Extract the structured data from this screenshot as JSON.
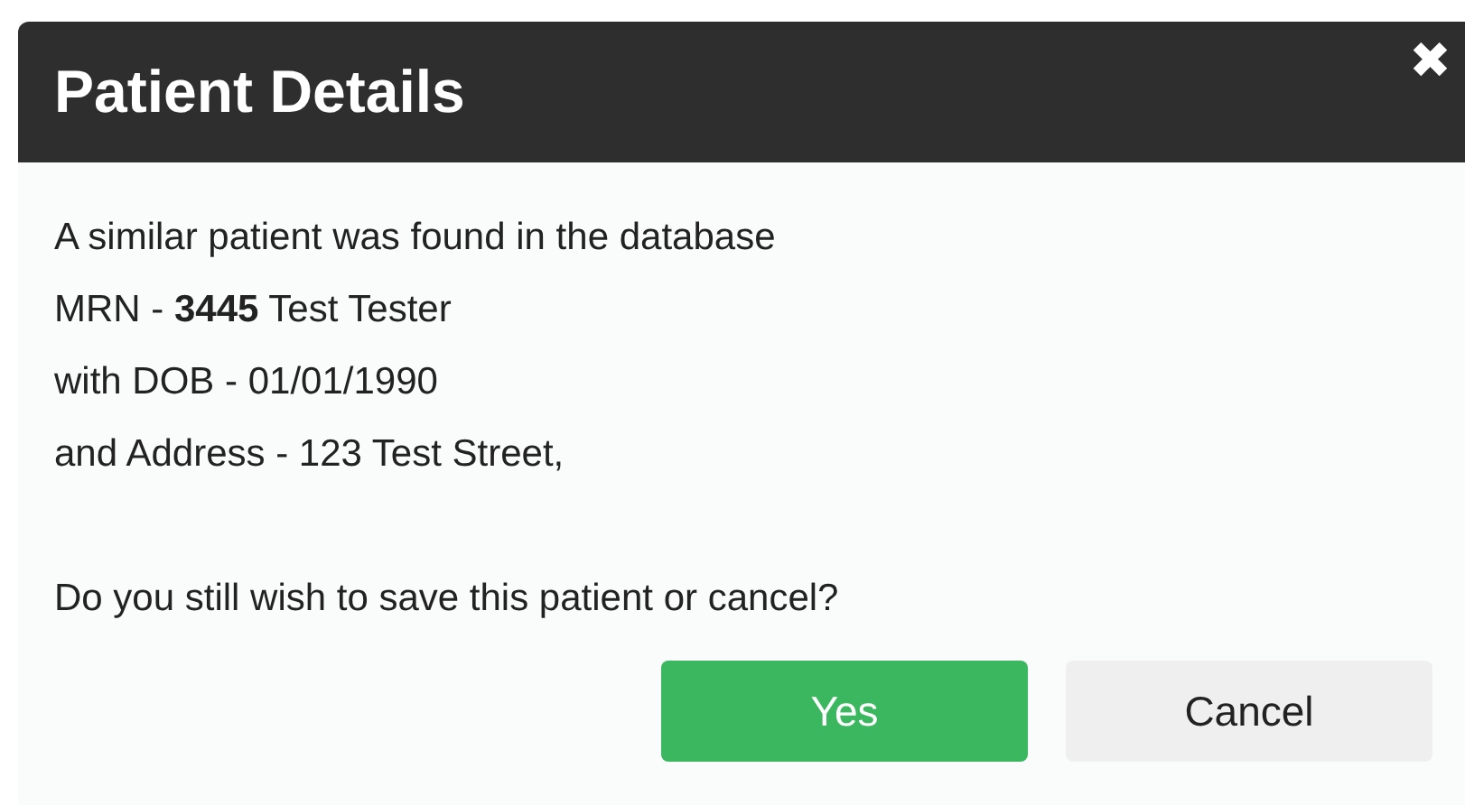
{
  "dialog": {
    "title": "Patient Details",
    "close": "✖",
    "message_lines": [
      "A similar patient was found in the database",
      "MRN - **3445** Test Tester",
      "with DOB - 01/01/1990",
      "and Address - 123 Test Street,"
    ],
    "question": "Do you still wish to save this patient or cancel?",
    "buttons": [
      {
        "label": "Yes",
        "kind": "primary"
      },
      {
        "label": "Cancel",
        "kind": "secondary"
      }
    ]
  }
}
